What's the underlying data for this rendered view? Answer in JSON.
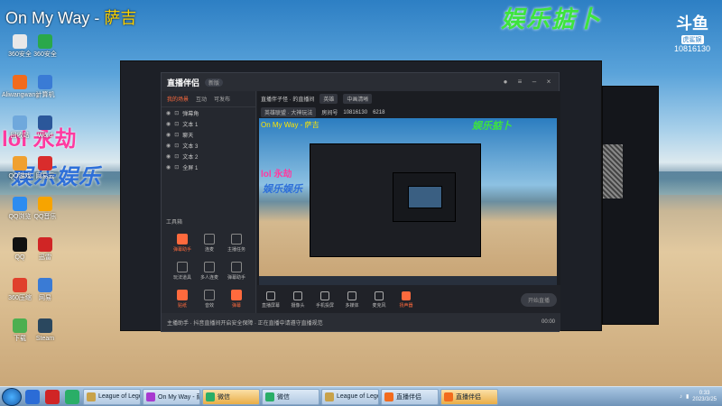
{
  "overlay": {
    "title_a": "On My Way - ",
    "title_b": "萨吉",
    "entertainment": "娱乐掂卜",
    "pink_text": "lol 永劫",
    "blue_text": "娱乐娱乐"
  },
  "douyu": {
    "logo": "斗鱼",
    "tag": "虎鲨娱",
    "room": "10816130"
  },
  "desktop_icons": [
    {
      "label": "360安全",
      "color": "#e8e8e8"
    },
    {
      "label": "360安全",
      "color": "#2aa84a"
    },
    {
      "label": "Aliwangwang",
      "color": "#f26b1d"
    },
    {
      "label": "计算机",
      "color": "#3a7bd5"
    },
    {
      "label": "回收站",
      "color": "#6fa8dc"
    },
    {
      "label": "Word",
      "color": "#2b579a"
    },
    {
      "label": "QQ游戏",
      "color": "#f0a030"
    },
    {
      "label": "网易云",
      "color": "#d92c2c"
    },
    {
      "label": "QQ浏览",
      "color": "#2d8cf0"
    },
    {
      "label": "QQ音乐",
      "color": "#f7a400"
    },
    {
      "label": "QQ",
      "color": "#111111"
    },
    {
      "label": "迅雷",
      "color": "#d02525"
    },
    {
      "label": "360压缩",
      "color": "#e0402c"
    },
    {
      "label": "网易",
      "color": "#3a7bd5"
    },
    {
      "label": "下载",
      "color": "#4caf50"
    },
    {
      "label": "Steam",
      "color": "#2a475e"
    }
  ],
  "app": {
    "name": "直播伴侣",
    "version_badge": "新版",
    "left_tabs": [
      "我的场景",
      "互动",
      "可发布"
    ],
    "sources": [
      "弹幕角",
      "文本 1",
      "聊天",
      "文本 3",
      "文本 2",
      "全屏 1"
    ],
    "tools_heading": "工具箱",
    "tools": [
      {
        "label": "弹幕助手",
        "hot": true
      },
      {
        "label": "连麦",
        "hot": false
      },
      {
        "label": "主播任务",
        "hot": false
      },
      {
        "label": "玩法道具",
        "hot": false
      },
      {
        "label": "多人连麦",
        "hot": false
      },
      {
        "label": "弹幕助手",
        "hot": false
      },
      {
        "label": "贴纸",
        "hot": true
      },
      {
        "label": "音效",
        "hot": false
      },
      {
        "label": "弹幕",
        "hot": true
      }
    ],
    "room": {
      "title": "直播伴子怪 · 的直播间",
      "category": "英雄",
      "clarity": "中画清晰",
      "game": "英雄联盟 · 大神玩法",
      "room_label": "房间号",
      "room_id": "10816130",
      "hot": "6218"
    },
    "preview": {
      "title": "On My Way - 萨吉",
      "ent": "娱乐掂卜",
      "pink": "lol 永劫",
      "blue": "娱乐娱乐"
    },
    "bottom_buttons": [
      {
        "label": "直播屏幕",
        "hot": false
      },
      {
        "label": "摄像头",
        "hot": false
      },
      {
        "label": "手机投屏",
        "hot": false
      },
      {
        "label": "多媒体",
        "hot": false
      },
      {
        "label": "麦克风",
        "hot": false
      },
      {
        "label": "扬声器",
        "hot": true
      }
    ],
    "start_live": "开始直播",
    "status": "主播助手 · 抖音直播间开启安全保障 · 正在直播中请遵守直播规范",
    "status_right": "00:00"
  },
  "taskbar": {
    "tasks": [
      {
        "label": "League of Lege...",
        "color": "#c8a24a",
        "active": false
      },
      {
        "label": "On My Way - 萨...",
        "color": "#a83ad0",
        "active": false
      },
      {
        "label": "微信",
        "color": "#2aae67",
        "active": true
      },
      {
        "label": "微信",
        "color": "#2aae67",
        "active": false
      },
      {
        "label": "League of Lege...",
        "color": "#c8a24a",
        "active": false
      },
      {
        "label": "直播伴侣",
        "color": "#f26b1d",
        "active": false
      },
      {
        "label": "直播伴侣",
        "color": "#f26b1d",
        "active": true
      }
    ],
    "time": "0:33",
    "date": "2023/3/25"
  }
}
